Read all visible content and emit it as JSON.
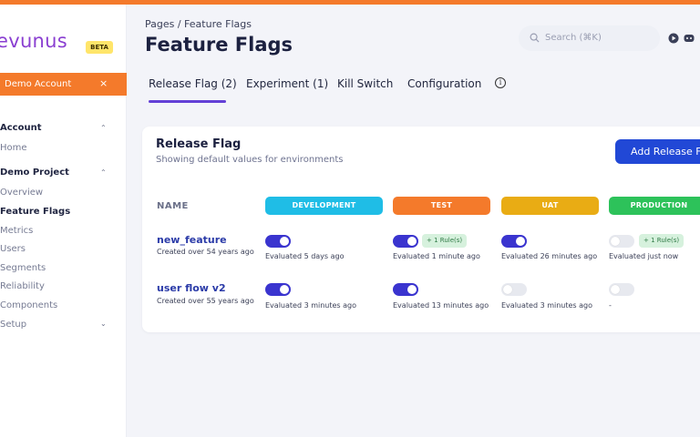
{
  "app": {
    "logo": "evunus",
    "badge": "BETA",
    "account_bar": "Demo Account",
    "account_close": "×",
    "accent_color": "#f47a2b",
    "primary_color": "#2148d6"
  },
  "sidebar": {
    "account_section": "Account",
    "account_items": [
      "Home"
    ],
    "project_section": "Demo Project",
    "project_items": [
      "Overview",
      "Feature Flags",
      "Metrics",
      "Users",
      "Segments",
      "Reliability",
      "Components",
      "Setup"
    ],
    "active_item": "Feature Flags"
  },
  "header": {
    "breadcrumb": "Pages  /  Feature Flags",
    "title": "Feature Flags",
    "search_placeholder": "Search (⌘K)"
  },
  "tabs": [
    {
      "label": "Release Flag (2)",
      "active": true
    },
    {
      "label": "Experiment (1)",
      "active": false
    },
    {
      "label": "Kill Switch",
      "active": false
    },
    {
      "label": "Configuration",
      "active": false
    }
  ],
  "card": {
    "title": "Release Flag",
    "subtitle": "Showing default values for environments",
    "add_button": "Add Release Flag"
  },
  "table": {
    "name_header": "NAME",
    "environments": [
      {
        "label": "DEVELOPMENT",
        "color": "#1fbde6"
      },
      {
        "label": "TEST",
        "color": "#f47a2b"
      },
      {
        "label": "UAT",
        "color": "#e9ac14"
      },
      {
        "label": "PRODUCTION",
        "color": "#2dc25a"
      }
    ],
    "rows": [
      {
        "name": "new_feature",
        "created": "Created over 54 years ago",
        "cells": [
          {
            "on": true,
            "rule": "",
            "evaluated": "Evaluated 5 days ago"
          },
          {
            "on": true,
            "rule": "+ 1 Rule(s)",
            "evaluated": "Evaluated 1 minute ago"
          },
          {
            "on": true,
            "rule": "",
            "evaluated": "Evaluated 26 minutes ago"
          },
          {
            "on": false,
            "rule": "+ 1 Rule(s)",
            "evaluated": "Evaluated just now"
          }
        ]
      },
      {
        "name": "user flow v2",
        "created": "Created over 55 years ago",
        "cells": [
          {
            "on": true,
            "rule": "",
            "evaluated": "Evaluated 3 minutes ago"
          },
          {
            "on": true,
            "rule": "",
            "evaluated": "Evaluated 13 minutes ago"
          },
          {
            "on": false,
            "rule": "",
            "evaluated": "Evaluated 3 minutes ago"
          },
          {
            "on": false,
            "rule": "",
            "evaluated": "-"
          }
        ]
      }
    ]
  }
}
